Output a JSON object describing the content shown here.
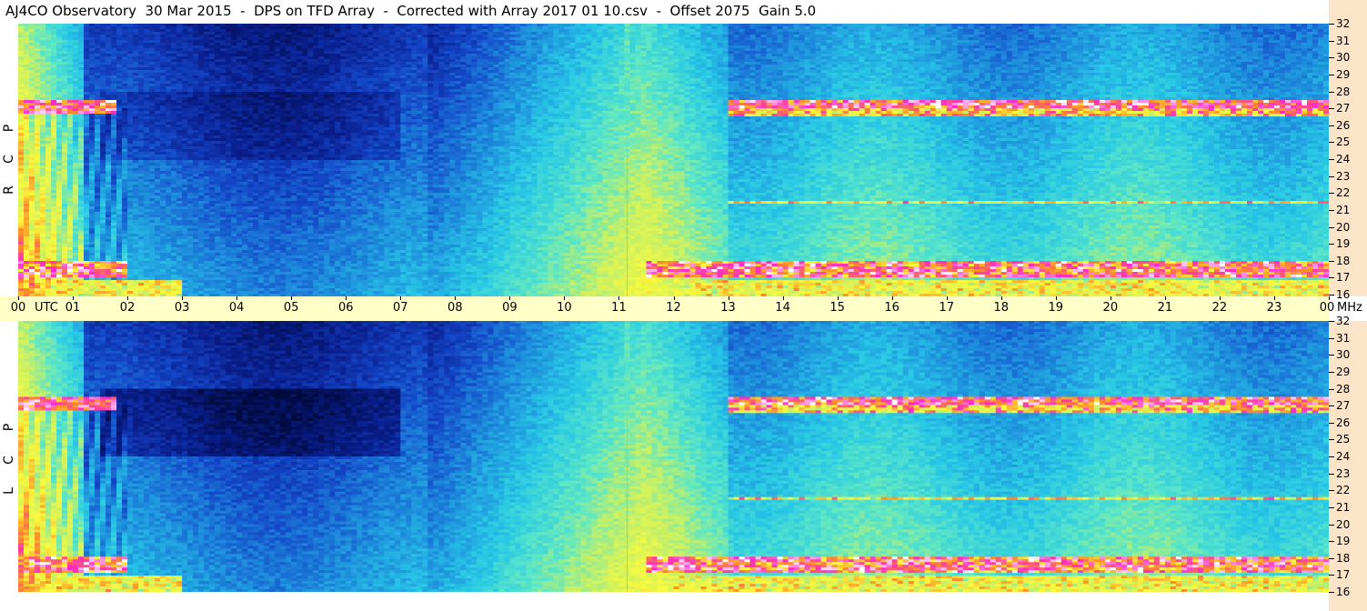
{
  "title": "AJ4CO Observatory  30 Mar 2015  -  DPS on TFD Array  -  Corrected with Array 2017 01 10.csv  -  Offset 2075  Gain 5.0",
  "chart_data": [
    {
      "type": "heatmap",
      "panel": "RCP",
      "side_label": [
        "R",
        "C",
        "P"
      ],
      "x": [
        "00",
        "01",
        "02",
        "03",
        "04",
        "05",
        "06",
        "07",
        "08",
        "09",
        "10",
        "11",
        "12",
        "13",
        "14",
        "15",
        "16",
        "17",
        "18",
        "19",
        "20",
        "21",
        "22",
        "23",
        "00"
      ],
      "x_unit_label": "UTC",
      "y": [
        16,
        17,
        18,
        19,
        20,
        21,
        22,
        23,
        24,
        25,
        26,
        27,
        28,
        29,
        30,
        31,
        32
      ],
      "y_unit_label": "MHz",
      "xlim": [
        0,
        24
      ],
      "ylim": [
        16,
        32
      ],
      "colormap": [
        "#000a3c",
        "#0a1e8c",
        "#1446c8",
        "#1e8cdc",
        "#28c8e6",
        "#5ae6c8",
        "#c8f064",
        "#fafa3c",
        "#ff8c28",
        "#ff28c8",
        "#ffffff"
      ],
      "features": {
        "quiet_hours_utc": [
          1.5,
          7.5
        ],
        "rfi_bands_mhz": [
          17.5,
          26.8,
          27.3,
          21.5
        ],
        "vertical_line_utc": 11.15
      }
    },
    {
      "type": "heatmap",
      "panel": "LCP",
      "side_label": [
        "L",
        "C",
        "P"
      ],
      "x": [
        "00",
        "01",
        "02",
        "03",
        "04",
        "05",
        "06",
        "07",
        "08",
        "09",
        "10",
        "11",
        "12",
        "13",
        "14",
        "15",
        "16",
        "17",
        "18",
        "19",
        "20",
        "21",
        "22",
        "23",
        "00"
      ],
      "x_unit_label": "UTC",
      "y": [
        16,
        17,
        18,
        19,
        20,
        21,
        22,
        23,
        24,
        25,
        26,
        27,
        28,
        29,
        30,
        31,
        32
      ],
      "y_unit_label": "MHz",
      "xlim": [
        0,
        24
      ],
      "ylim": [
        16,
        32
      ],
      "colormap": [
        "#000a3c",
        "#0a1e8c",
        "#1446c8",
        "#1e8cdc",
        "#28c8e6",
        "#5ae6c8",
        "#c8f064",
        "#fafa3c",
        "#ff8c28",
        "#ff28c8",
        "#ffffff"
      ],
      "features": {
        "quiet_hours_utc": [
          1.5,
          7.5
        ],
        "rfi_bands_mhz": [
          17.5,
          26.8,
          27.3,
          21.5
        ],
        "vertical_line_utc": 11.15
      }
    }
  ]
}
